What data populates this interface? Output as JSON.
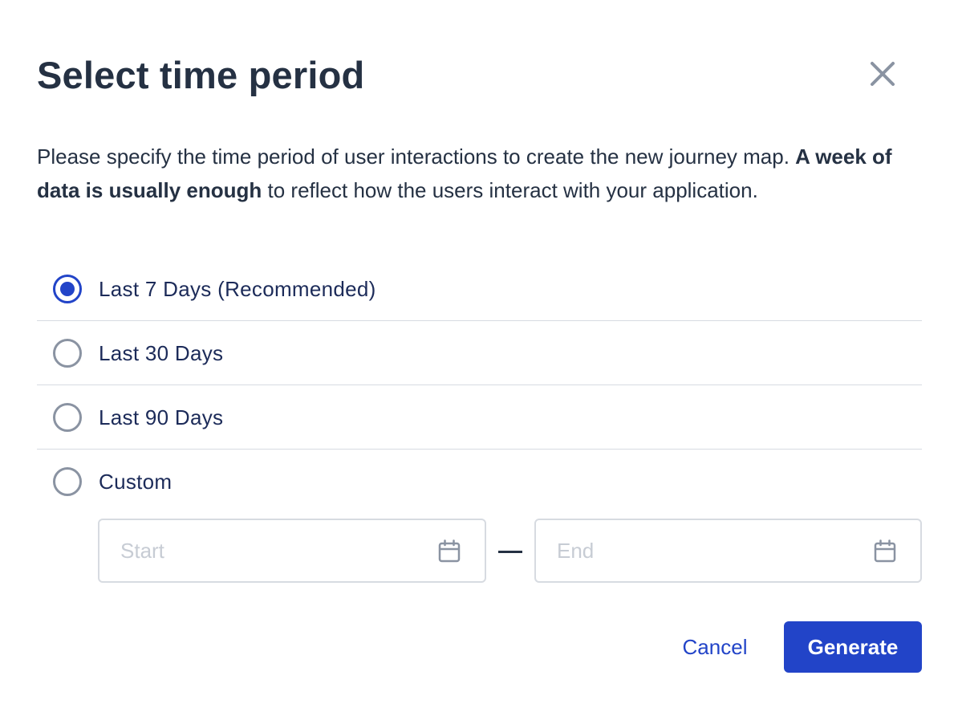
{
  "dialog": {
    "title": "Select time period",
    "description_part1": "Please specify the time period of user interactions to create the new journey map. ",
    "description_bold": "A week of data is usually enough",
    "description_part2": " to reflect how the users interact with your application."
  },
  "options": [
    {
      "label": "Last 7 Days (Recommended)",
      "selected": true
    },
    {
      "label": "Last 30 Days",
      "selected": false
    },
    {
      "label": "Last 90 Days",
      "selected": false
    },
    {
      "label": "Custom",
      "selected": false
    }
  ],
  "custom_range": {
    "start_placeholder": "Start",
    "end_placeholder": "End",
    "start_value": "",
    "end_value": ""
  },
  "actions": {
    "cancel_label": "Cancel",
    "generate_label": "Generate"
  },
  "colors": {
    "accent": "#2244c8",
    "text": "#253143",
    "border": "#d7dbe1",
    "placeholder": "#c7ccd4"
  },
  "icons": {
    "close": "close-icon",
    "calendar": "calendar-icon"
  }
}
